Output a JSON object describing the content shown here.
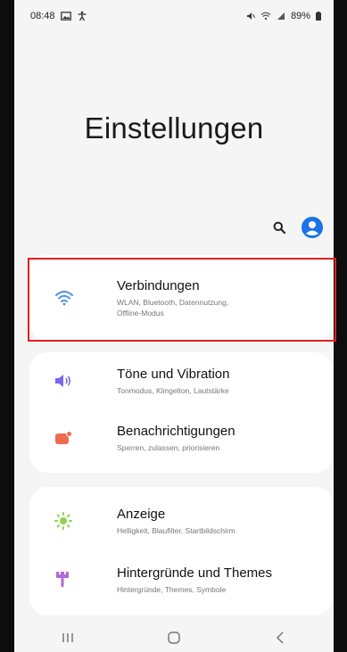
{
  "status_bar": {
    "time": "08:48",
    "battery": "89%",
    "icons": [
      "gallery-icon",
      "accessibility-icon",
      "mute-icon",
      "wifi-icon",
      "signal-icon",
      "battery-icon"
    ]
  },
  "header": {
    "title": "Einstellungen"
  },
  "actions": {
    "search_icon": "search-icon",
    "profile_icon": "profile-icon"
  },
  "settings": [
    {
      "label": "Verbindungen",
      "subtitle_line1": "WLAN, Bluetooth, Datennutzung,",
      "subtitle_line2": "Offline-Modus",
      "icon": "wifi-icon",
      "icon_color": "#4a90e2",
      "highlighted": true
    },
    {
      "label": "Töne und Vibration",
      "subtitle_line1": "Tonmodus, Klingelton, Lautstärke",
      "icon": "volume-icon",
      "icon_color": "#7b68ee"
    },
    {
      "label": "Benachrichtigungen",
      "subtitle_line1": "Sperren, zulassen, priorisieren",
      "icon": "notification-icon",
      "icon_color": "#f06a50"
    },
    {
      "label": "Anzeige",
      "subtitle_line1": "Helligkeit, Blaufilter, Startbildschirm",
      "icon": "sun-icon",
      "icon_color": "#8fd14f"
    },
    {
      "label": "Hintergründe und Themes",
      "subtitle_line1": "Hintergründe, Themes, Symbole",
      "icon": "brush-icon",
      "icon_color": "#b06ad8"
    }
  ],
  "nav_bar": {
    "items": [
      "recents-icon",
      "home-icon",
      "back-icon"
    ]
  },
  "colors": {
    "highlight_border": "#e02020",
    "profile_blue": "#1a73e8"
  }
}
